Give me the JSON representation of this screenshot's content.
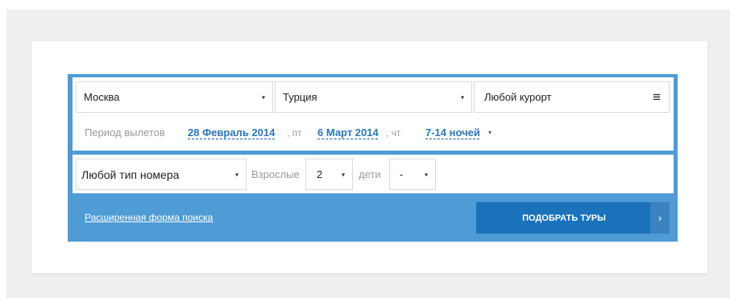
{
  "search": {
    "departure_city": "Москва",
    "country": "Турция",
    "resort": "Любой курорт",
    "period_label": "Период вылетов",
    "date_from": "28 Февраль 2014",
    "date_from_day": ", пт",
    "date_to": "6 Март 2014",
    "date_to_day": ", чт",
    "nights": "7-14 ночей",
    "room_type": "Любой тип номера",
    "adults_label": "Взрослые",
    "adults_value": "2",
    "children_label": "дети",
    "children_value": "-",
    "advanced_link": "Расширенная форма поиска",
    "submit_label": "ПОДОБРАТЬ ТУРЫ"
  },
  "icons": {
    "dropdown": "▾",
    "menu": "≡",
    "chevron": "›"
  },
  "colors": {
    "panel": "#4f9bd6",
    "button": "#1a72bb",
    "link": "#2a75b9"
  }
}
